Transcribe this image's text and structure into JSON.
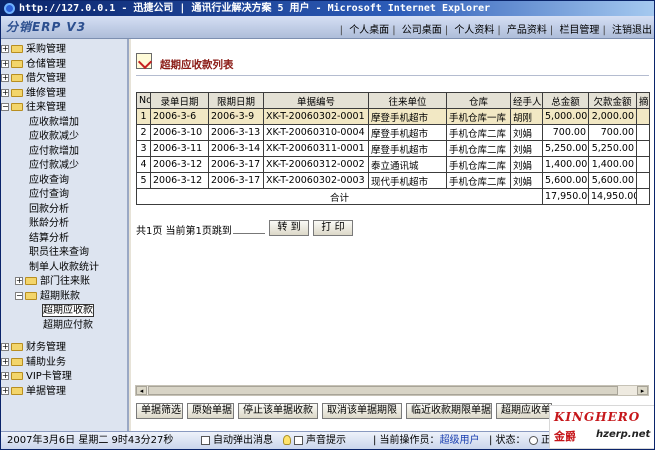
{
  "window": {
    "title": "http://127.0.0.1 - 迅捷公司 | 通讯行业解决方案 5 用户 - Microsoft Internet Explorer"
  },
  "header": {
    "logo": "分销ERP V3",
    "nav": [
      "个人桌面",
      "公司桌面",
      "个人资料",
      "产品资料",
      "栏目管理",
      "注销退出"
    ]
  },
  "sidebar": {
    "groups_top": [
      "采购管理",
      "仓储管理",
      "借欠管理",
      "维修管理"
    ],
    "open_group": "往来管理",
    "items": [
      "应收款增加",
      "应收款减少",
      "应付款增加",
      "应付款减少",
      "应收查询",
      "应付查询",
      "回款分析",
      "账龄分析",
      "结算分析",
      "职员往来查询",
      "制单人收款统计"
    ],
    "sub_group_1": "部门往来账",
    "sub_group_2": "超期账款",
    "sub_items": [
      "超期应收款",
      "超期应付款"
    ],
    "groups_bottom": [
      "财务管理",
      "辅助业务",
      "VIP卡管理",
      "单据管理"
    ]
  },
  "page": {
    "title": "超期应收款列表",
    "columns": [
      "No.",
      "录单日期",
      "限期日期",
      "单据编号",
      "往来单位",
      "仓库",
      "经手人",
      "总金额",
      "欠款金额",
      "摘要"
    ],
    "rows": [
      [
        "1",
        "2006-3-6",
        "2006-3-9",
        "XK-T-20060302-0001",
        "摩登手机超市",
        "手机仓库一库",
        "胡刚",
        "5,000.00",
        "2,000.00",
        ""
      ],
      [
        "2",
        "2006-3-10",
        "2006-3-13",
        "XK-T-20060310-0004",
        "摩登手机超市",
        "手机仓库二库",
        "刘娟",
        "700.00",
        "700.00",
        ""
      ],
      [
        "3",
        "2006-3-11",
        "2006-3-14",
        "XK-T-20060311-0001",
        "摩登手机超市",
        "手机仓库二库",
        "刘娟",
        "5,250.00",
        "5,250.00",
        ""
      ],
      [
        "4",
        "2006-3-12",
        "2006-3-17",
        "XK-T-20060312-0002",
        "泰立通讯城",
        "手机仓库二库",
        "刘娟",
        "1,400.00",
        "1,400.00",
        ""
      ],
      [
        "5",
        "2006-3-12",
        "2006-3-17",
        "XK-T-20060302-0003",
        "现代手机超市",
        "手机仓库二库",
        "刘娟",
        "5,600.00",
        "5,600.00",
        ""
      ]
    ],
    "total_label": "合计",
    "total_amount": "17,950.00",
    "total_owed": "14,950.00",
    "pager_text": "共1页 当前第1页跳到",
    "jump_button": "转 到",
    "print_button": "打 印",
    "bottom_buttons": [
      "单据筛选",
      "原始单据",
      "停止该单据收款",
      "取消该单据期限",
      "临近收款期限单据",
      "超期应收单"
    ]
  },
  "status": {
    "datetime": "2007年3月6日 星期二 9时43分27秒",
    "auto_popup": "自动弹出消息",
    "sound": "声音提示",
    "operator_label": "| 当前操作员：",
    "operator": "超级用户",
    "state_label": "| 状态：",
    "state_value": "正"
  },
  "brand": {
    "name": "KINGHERO",
    "cn": "金爵",
    "url": "hzerp.net"
  },
  "colors": {
    "title_text": "#8a1a14",
    "brand_red": "#c6161a",
    "highlight_row": "#f2e8c4"
  }
}
